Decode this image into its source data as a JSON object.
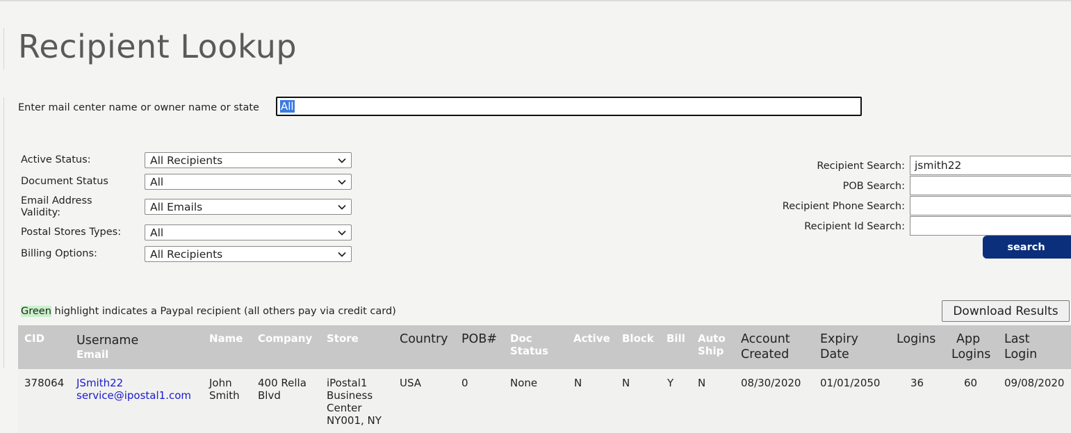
{
  "page_title": "Recipient Lookup",
  "lookup": {
    "label": "Enter mail center name or owner name or state",
    "value": "All"
  },
  "filters": [
    {
      "label": "Active Status:",
      "value": "All Recipients"
    },
    {
      "label": "Document Status",
      "value": "All"
    },
    {
      "label": "Email Address Validity:",
      "value": "All Emails"
    },
    {
      "label": "Postal Stores Types:",
      "value": "All"
    },
    {
      "label": "Billing Options:",
      "value": "All Recipients"
    }
  ],
  "search": {
    "recipient_label": "Recipient Search:",
    "recipient_value": "jsmith22",
    "pob_label": "POB Search:",
    "pob_value": "",
    "phone_label": "Recipient Phone Search:",
    "phone_value": "",
    "id_label": "Recipient Id Search:",
    "id_value": "",
    "button_label": "search"
  },
  "note": {
    "highlight": "Green",
    "text": " highlight indicates a Paypal recipient (all others pay via credit card)"
  },
  "download_label": "Download Results",
  "table": {
    "headers": {
      "cid": "CID",
      "username": "Username",
      "email": "Email",
      "name": "Name",
      "company": "Company",
      "store": "Store",
      "country": "Country",
      "pob": "POB#",
      "doc_status_1": "Doc",
      "doc_status_2": "Status",
      "active": "Active",
      "block": "Block",
      "bill": "Bill",
      "auto_ship_1": "Auto",
      "auto_ship_2": "Ship",
      "account_created_1": "Account",
      "account_created_2": "Created",
      "expiry_date_1": "Expiry",
      "expiry_date_2": "Date",
      "logins": "Logins",
      "app_logins_1": "App",
      "app_logins_2": "Logins",
      "last_login_1": "Last",
      "last_login_2": "Login"
    },
    "rows": [
      {
        "cid": "378064",
        "username": "JSmith22",
        "email": "service@ipostal1.com",
        "name_1": "John",
        "name_2": "Smith",
        "company_1": "400 Rella",
        "company_2": "Blvd",
        "store_1": "iPostal1",
        "store_2": "Business",
        "store_3": "Center",
        "store_4": "NY001, NY",
        "country": "USA",
        "pob": "0",
        "doc_status": "None",
        "active": "N",
        "block": "N",
        "bill": "Y",
        "auto_ship": "N",
        "account_created": "08/30/2020",
        "expiry_date": "01/01/2050",
        "logins": "36",
        "app_logins": "60",
        "last_login": "09/08/2020"
      }
    ]
  }
}
